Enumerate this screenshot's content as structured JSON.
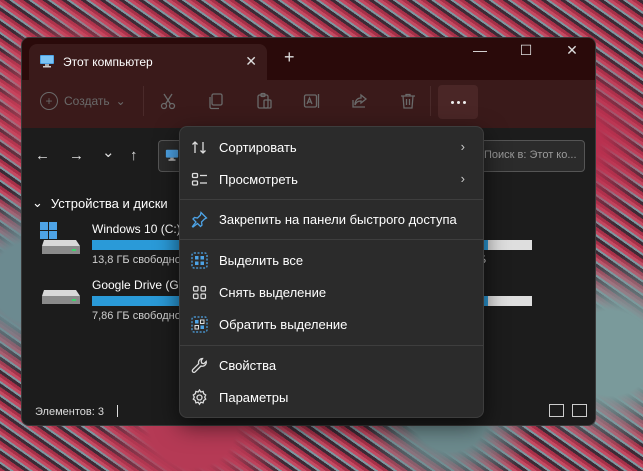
{
  "window": {
    "tab_title": "Этот компьютер",
    "tab_close": "✕",
    "new_tab": "+",
    "minimize": "—",
    "maximize": "☐",
    "close": "✕"
  },
  "toolbar": {
    "create_label": "Создать",
    "create_chevron": "⌄",
    "icons": [
      "cut-icon",
      "copy-icon",
      "paste-icon",
      "rename-icon",
      "share-icon",
      "delete-icon",
      "more-icon"
    ]
  },
  "nav": {
    "back": "←",
    "forward": "→",
    "history": "⌄",
    "up": "↑",
    "search_placeholder": "Поиск в: Этот ко..."
  },
  "section": {
    "chevron": "⌄",
    "title": "Устройства и диски"
  },
  "drives": [
    {
      "name": "Windows 10 (C:)",
      "free": "13,8 ГБ свободно",
      "used_fraction": 0.9,
      "suffix": "Б"
    },
    {
      "name": "Google Drive (G:)",
      "free": "7,86 ГБ свободно",
      "used_fraction": 0.9,
      "suffix": ""
    }
  ],
  "status": {
    "count": "Элементов: 3"
  },
  "menu": {
    "items": [
      {
        "label": "Сортировать",
        "icon": "sort-icon",
        "has_submenu": true
      },
      {
        "label": "Просмотреть",
        "icon": "view-icon",
        "has_submenu": true
      },
      {
        "label": "Закрепить на панели быстрого доступа",
        "icon": "pin-icon"
      },
      {
        "label": "Выделить все",
        "icon": "select-all-icon"
      },
      {
        "label": "Снять выделение",
        "icon": "select-none-icon"
      },
      {
        "label": "Обратить выделение",
        "icon": "invert-selection-icon"
      },
      {
        "label": "Свойства",
        "icon": "properties-icon"
      },
      {
        "label": "Параметры",
        "icon": "options-icon"
      }
    ],
    "chevron": "›"
  },
  "colors": {
    "accent": "#2a9ad8",
    "titlebar": "#2a0a0a",
    "toolbar": "#3a1a1a",
    "menu_bg": "#2b2b2b",
    "icon_blue": "#4da3e6"
  }
}
